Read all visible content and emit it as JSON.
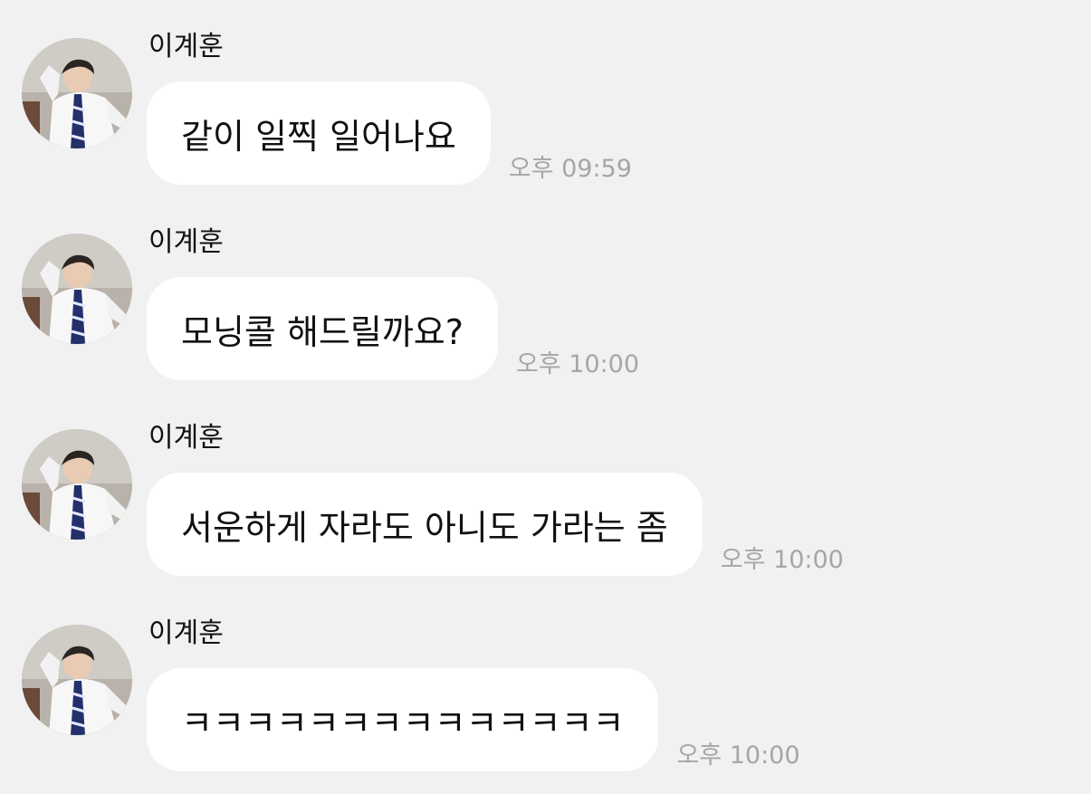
{
  "messages": [
    {
      "sender": "이계훈",
      "text": "같이 일찍 일어나요",
      "time": "오후 09:59"
    },
    {
      "sender": "이계훈",
      "text": "모닝콜 해드릴까요?",
      "time": "오후 10:00"
    },
    {
      "sender": "이계훈",
      "text": "서운하게 자라도 아니도 가라는 좀",
      "time": "오후 10:00"
    },
    {
      "sender": "이계훈",
      "text": "ㅋㅋㅋㅋㅋㅋㅋㅋㅋㅋㅋㅋㅋㅋ",
      "time": "오후 10:00"
    }
  ],
  "colors": {
    "background": "#f1f1f1",
    "bubble": "#ffffff",
    "timestamp": "#a6a6a6",
    "text": "#111111"
  },
  "icons": {
    "avatar": "profile-photo"
  }
}
